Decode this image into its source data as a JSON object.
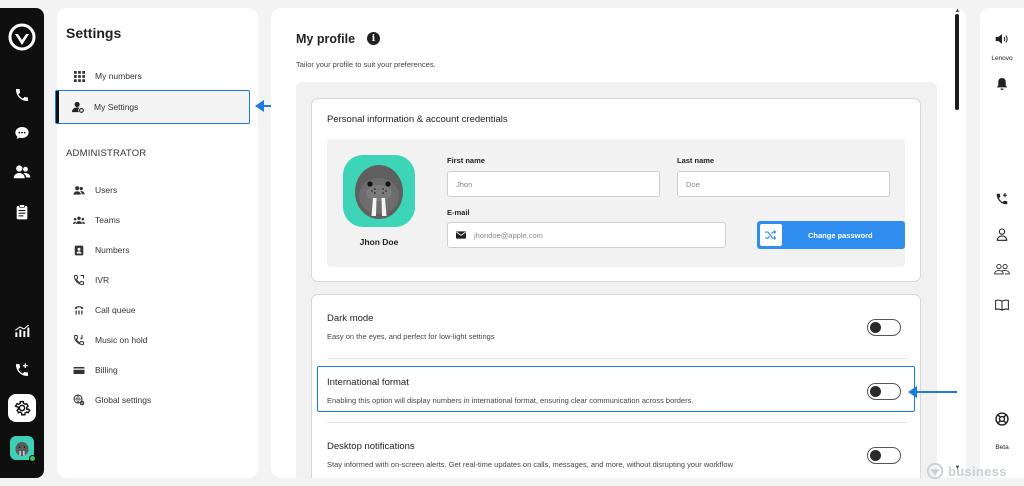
{
  "colors": {
    "accent": "#1f7ae0",
    "button": "#2f8df0",
    "avatar": "#3dd4b8",
    "rail": "#0f0f0f"
  },
  "rail": {
    "icons": [
      "app-logo-icon",
      "phone-icon",
      "chat-icon",
      "contacts-icon",
      "notes-icon",
      "analytics-icon",
      "call-add-icon",
      "gear-icon",
      "avatar"
    ]
  },
  "settings": {
    "title": "Settings",
    "items": [
      {
        "label": "My numbers",
        "icon": "grid-icon"
      },
      {
        "label": "My Settings",
        "icon": "user-gear-icon",
        "active": true
      }
    ],
    "admin_title": "ADMINISTRATOR",
    "admin_items": [
      {
        "label": "Users",
        "icon": "users-icon"
      },
      {
        "label": "Teams",
        "icon": "teams-icon"
      },
      {
        "label": "Numbers",
        "icon": "number-icon"
      },
      {
        "label": "IVR",
        "icon": "ivr-icon"
      },
      {
        "label": "Call queue",
        "icon": "call-queue-icon"
      },
      {
        "label": "Music on hold",
        "icon": "music-hold-icon"
      },
      {
        "label": "Billing",
        "icon": "billing-icon"
      },
      {
        "label": "Global settings",
        "icon": "globe-gear-icon"
      }
    ]
  },
  "main": {
    "title": "My profile",
    "subtitle": "Tailor your profile to suit your preferences.",
    "personal": {
      "title": "Personal information & account credentials",
      "name": "Jhon Doe",
      "first_name_label": "First name",
      "first_name_value": "Jhon",
      "last_name_label": "Last name",
      "last_name_value": "Doe",
      "email_label": "E-mail",
      "email_value": "jhondoe@apple.com",
      "change_password": "Change password"
    },
    "preferences": [
      {
        "title": "Dark mode",
        "desc": "Easy on the eyes, and perfect for low-light settings",
        "on": false
      },
      {
        "title": "International format",
        "desc": "Enabling this option will display numbers in international format, ensuring clear communication across borders.",
        "on": false,
        "highlighted": true
      },
      {
        "title": "Desktop notifications",
        "desc": "Stay informed with on-screen alerts. Get real-time updates on calls, messages, and more, without disrupting your workflow",
        "on": false
      }
    ]
  },
  "rightbar": {
    "device_label": "Lenovo",
    "beta_label": "Beta"
  },
  "watermark": {
    "text": "business"
  }
}
